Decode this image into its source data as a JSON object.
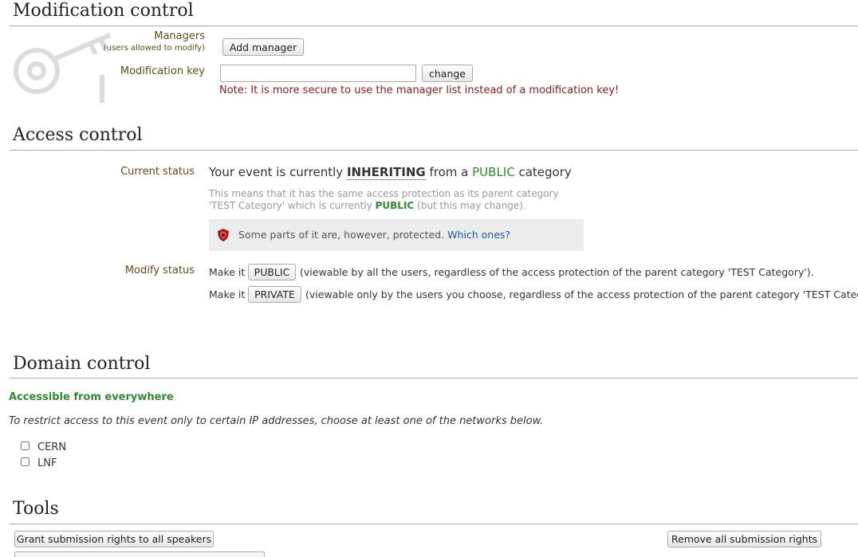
{
  "modification": {
    "title": "Modification control",
    "managers_label": "Managers",
    "managers_sub": "(users allowed to modify)",
    "add_manager_label": "Add manager",
    "modkey_label": "Modification key",
    "modkey_value": "",
    "change_label": "change",
    "note": "Note: It is more secure to use the manager list instead of a modification key!"
  },
  "access": {
    "title": "Access control",
    "current_status_label": "Current status",
    "status_prefix": "Your event is currently ",
    "status_inheriting": "INHERITING",
    "status_mid": " from a ",
    "status_public": "PUBLIC",
    "status_suffix": " category",
    "desc_line1": "This means that it has the same access protection as its parent category",
    "desc_line2_prefix": "'TEST Category' which is currently ",
    "desc_line2_public": "PUBLIC",
    "desc_line2_suffix": " (but this may change).",
    "protected_text": "Some parts of it are, however, protected. ",
    "which_ones_link": "Which ones?",
    "modify_status_label": "Modify status",
    "make_it_1": "Make it",
    "public_button": "PUBLIC",
    "public_desc": "(viewable by all the users, regardless of the access protection of the parent category 'TEST Category').",
    "make_it_2": "Make it",
    "private_button": "PRIVATE",
    "private_desc": "(viewable only by the users you choose, regardless of the access protection of the parent category 'TEST Category')."
  },
  "domain": {
    "title": "Domain control",
    "accessible": "Accessible from everywhere",
    "restrict_text": "To restrict access to this event only to certain IP addresses, choose at least one of the networks below.",
    "networks": [
      {
        "label": "CERN",
        "checked": false
      },
      {
        "label": "LNF",
        "checked": false
      }
    ]
  },
  "tools": {
    "title": "Tools",
    "grant_button": "Grant submission rights to all speakers",
    "remove_button": "Remove all submission rights"
  },
  "colors": {
    "label_brown": "#5f4b1a",
    "note_red": "#8b1a1a",
    "public_green": "#2e8b2e",
    "link_blue": "#1a5aa6"
  }
}
